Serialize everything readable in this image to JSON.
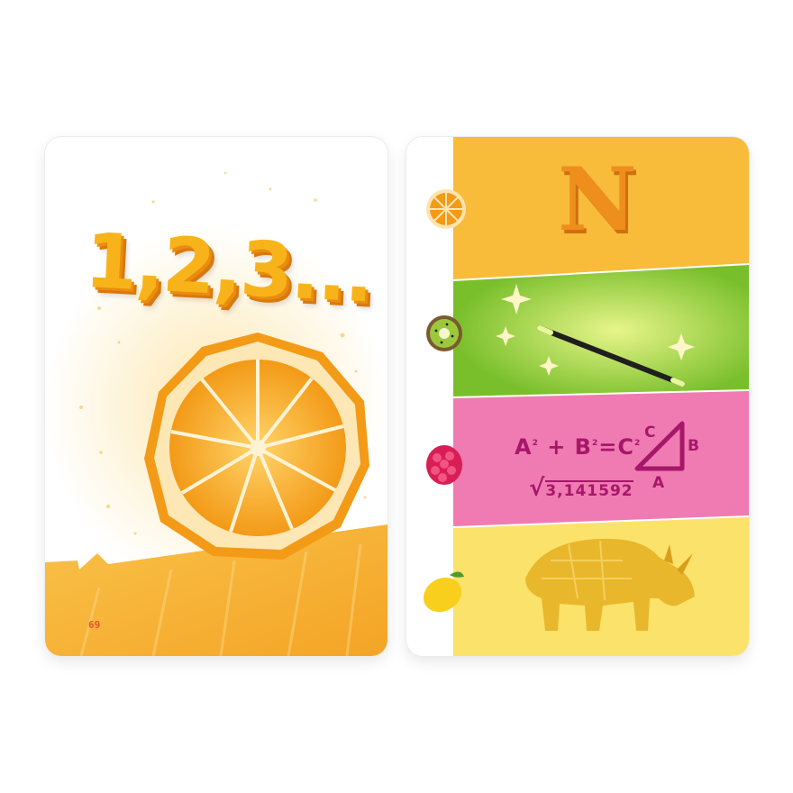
{
  "left_card": {
    "headline": "1,2,3...",
    "page_number": "69",
    "illustration": "orange-slice-icon",
    "colors": {
      "orange": "#f9b31a",
      "band": "#f7b733"
    }
  },
  "right_card": {
    "letter": "N",
    "rows": [
      {
        "fruit": "orange-icon",
        "picture": "letter-n",
        "color": "#f8bb3a"
      },
      {
        "fruit": "kiwi-icon",
        "picture": "magic-wand-icon",
        "color": "#8cc63f"
      },
      {
        "fruit": "raspberry-icon",
        "picture": "math-formula",
        "color": "#f07bb2"
      },
      {
        "fruit": "lemon-icon",
        "picture": "rhino-icon",
        "color": "#fbe26a"
      }
    ],
    "math": {
      "A": "A",
      "B": "B",
      "C": "C",
      "exp": "2",
      "plus": "+",
      "equals": "=",
      "pi_value": "3,141592"
    },
    "triangle_labels": {
      "top": "C",
      "side": "B",
      "bottom": "A"
    }
  }
}
